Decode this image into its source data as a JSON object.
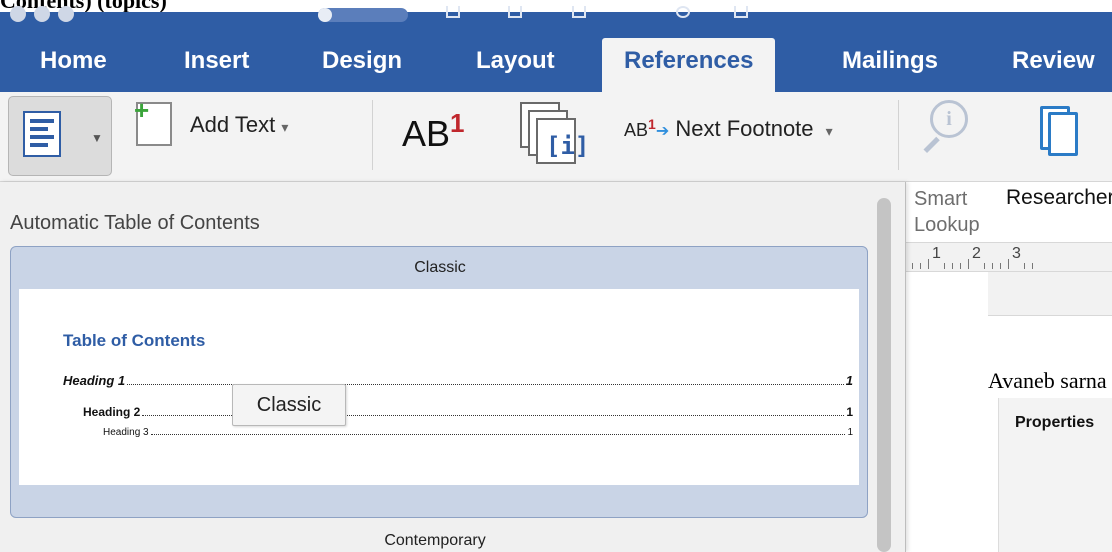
{
  "document_top_text": "Contents) (topics)",
  "tabs": [
    {
      "label": "Home"
    },
    {
      "label": "Insert"
    },
    {
      "label": "Design"
    },
    {
      "label": "Layout"
    },
    {
      "label": "References",
      "active": true
    },
    {
      "label": "Mailings"
    },
    {
      "label": "Review"
    }
  ],
  "ribbon": {
    "add_text_label": "Add Text",
    "add_text_caret": "▾",
    "insert_footnote_text": "AB",
    "insert_footnote_sup": "1",
    "insert_endnote_glyph": "[i]",
    "next_footnote_ab": "AB",
    "next_footnote_sup": "1",
    "next_footnote_label": "Next Footnote",
    "next_footnote_caret": "▾",
    "smart_lookup_label_1": "Smart",
    "smart_lookup_label_2": "Lookup",
    "research_label": "Researcher"
  },
  "gallery": {
    "title": "Automatic Table of Contents",
    "options": [
      {
        "name": "Classic"
      },
      {
        "name": "Contemporary"
      }
    ],
    "preview": {
      "heading": "Table of Contents",
      "rows": [
        {
          "label": "Heading 1",
          "page": "1"
        },
        {
          "label": "Heading 2",
          "page": "1"
        },
        {
          "label": "Heading 3",
          "page": "1"
        }
      ]
    },
    "tooltip": "Classic"
  },
  "document": {
    "ruler_numbers": [
      "1",
      "2",
      "3"
    ],
    "name_text": "Avaneb sarna",
    "properties_label": "Properties"
  },
  "colors": {
    "accent": "#2f5da5",
    "footnote_red": "#c0272d",
    "selection_fill": "#c9d4e6"
  }
}
